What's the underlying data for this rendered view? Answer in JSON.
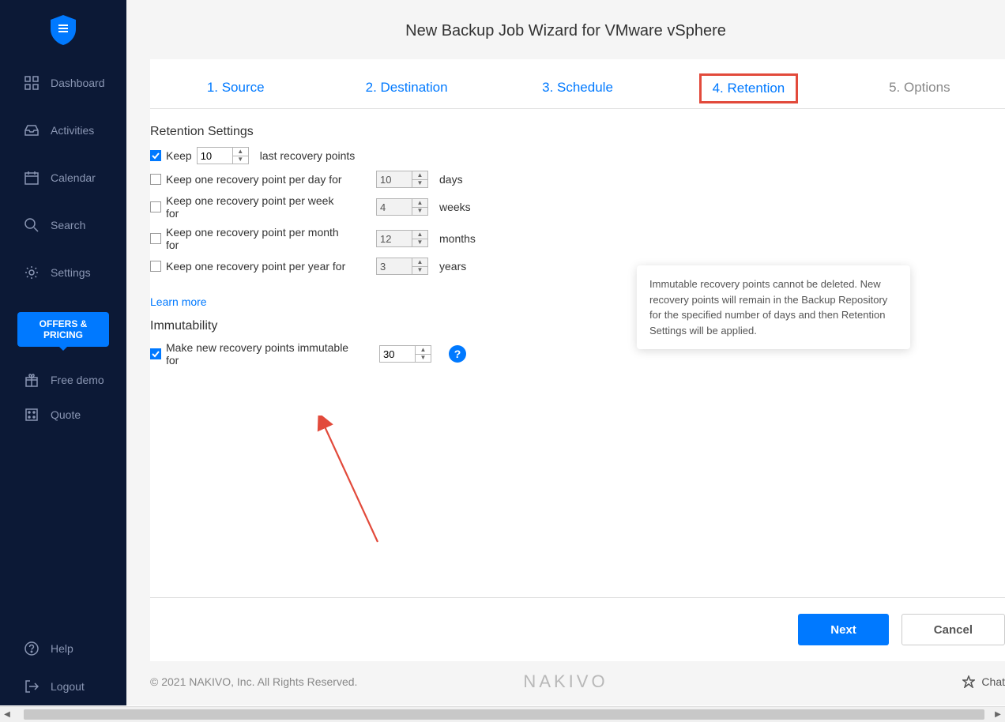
{
  "sidebar": {
    "items": [
      {
        "label": "Dashboard"
      },
      {
        "label": "Activities"
      },
      {
        "label": "Calendar"
      },
      {
        "label": "Search"
      },
      {
        "label": "Settings"
      }
    ],
    "offers_btn": "OFFERS & PRICING",
    "free_demo": "Free demo",
    "quote": "Quote",
    "help": "Help",
    "logout": "Logout"
  },
  "page_title": "New Backup Job Wizard for VMware vSphere",
  "tabs": [
    {
      "label": "1. Source"
    },
    {
      "label": "2. Destination"
    },
    {
      "label": "3. Schedule"
    },
    {
      "label": "4. Retention"
    },
    {
      "label": "5. Options"
    }
  ],
  "retention": {
    "title": "Retention Settings",
    "keep_label": "Keep",
    "keep_value": "10",
    "keep_suffix": "last recovery points",
    "rows": [
      {
        "label": "Keep one recovery point per day for",
        "value": "10",
        "unit": "days"
      },
      {
        "label": "Keep one recovery point per week for",
        "value": "4",
        "unit": "weeks"
      },
      {
        "label": "Keep one recovery point per month for",
        "value": "12",
        "unit": "months"
      },
      {
        "label": "Keep one recovery point per year for",
        "value": "3",
        "unit": "years"
      }
    ],
    "learn_more": "Learn more"
  },
  "immutability": {
    "title": "Immutability",
    "label": "Make new recovery points immutable for",
    "value": "30",
    "tooltip": "Immutable recovery points cannot be deleted. New recovery points will remain in the Backup Repository for the specified number of days and then Retention Settings will be applied."
  },
  "buttons": {
    "next": "Next",
    "cancel": "Cancel"
  },
  "footer": {
    "copyright": "© 2021 NAKIVO, Inc. All Rights Reserved.",
    "brand": "NAKIVO",
    "chat": "Chat"
  }
}
